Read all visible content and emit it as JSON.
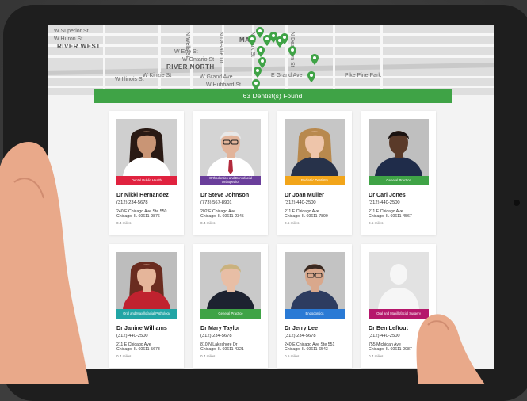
{
  "map": {
    "labels": [
      "W Superior St",
      "W Huron St",
      "RIVER WEST",
      "W Erie St",
      "W Ontario St",
      "RIVER NORTH",
      "W Grand Ave",
      "W Illinois St",
      "W Hubbard St",
      "W Kinzie St",
      "N Wells St",
      "N LaSalle Dr",
      "N Clark St",
      "N Dearborn St",
      "MA",
      "Pike Pine Park",
      "E Grand Ave"
    ]
  },
  "results": {
    "count_label": "63 Dentist(s) Found"
  },
  "dentists": [
    {
      "name": "Dr Nikki Hernandez",
      "specialty": "Dental Public Health",
      "specialty_color": "#e0223f",
      "phone": "(312) 234-5678",
      "address_line1": "240 E Chicago Ave Ste 550",
      "address_line2": "Chicago, IL 60611-9876",
      "distance": "0.4 miles",
      "photo": "woman-dark-hair"
    },
    {
      "name": "Dr Steve Johnson",
      "specialty": "Orthodontics and Dentofacial Orthopedics",
      "specialty_color": "#6a3e9b",
      "phone": "(773) 567-8901",
      "address_line1": "202 E Chicago Ave",
      "address_line2": "Chicago, IL 60611-2345",
      "distance": "0.4 miles",
      "photo": "older-man-glasses"
    },
    {
      "name": "Dr Joan Muller",
      "specialty": "Pediatric Dentistry",
      "specialty_color": "#f2a51a",
      "phone": "(312) 440-2500",
      "address_line1": "211 E Chicago Ave",
      "address_line2": "Chicago, IL 60611-7890",
      "distance": "0.5 miles",
      "photo": "woman-blonde"
    },
    {
      "name": "Dr Carl Jones",
      "specialty": "General Practice",
      "specialty_color": "#3fa346",
      "phone": "(312) 440-2500",
      "address_line1": "211 E Chicago Ave",
      "address_line2": "Chicago, IL 60611-4567",
      "distance": "0.5 miles",
      "photo": "man-dark-skin"
    },
    {
      "name": "Dr Janine Williams",
      "specialty": "Oral and Maxillofacial Pathology",
      "specialty_color": "#22a5a5",
      "phone": "(312) 440-2500",
      "address_line1": "211 E Chicago Ave",
      "address_line2": "Chicago, IL 60611-5678",
      "distance": "0.4 miles",
      "photo": "woman-auburn"
    },
    {
      "name": "Dr Mary Taylor",
      "specialty": "General Practice",
      "specialty_color": "#3fa346",
      "phone": "(312) 234-5678",
      "address_line1": "810 N Lakeshore Dr",
      "address_line2": "Chicago, IL 60611-4321",
      "distance": "0.4 miles",
      "photo": "older-woman"
    },
    {
      "name": "Dr Jerry Lee",
      "specialty": "Endodontics",
      "specialty_color": "#2a7ad5",
      "phone": "(312) 234-5678",
      "address_line1": "240 E Chicago Ave Ste 551",
      "address_line2": "Chicago, IL 60611-6543",
      "distance": "0.5 miles",
      "photo": "man-glasses"
    },
    {
      "name": "Dr Ben Leftout",
      "specialty": "Oral and Maxillofacial Surgery",
      "specialty_color": "#b5176b",
      "phone": "(312) 440-2500",
      "address_line1": "755 Michigan Ave",
      "address_line2": "Chicago, IL 60611-0987",
      "distance": "0.4 miles",
      "photo": "placeholder-silhouette"
    }
  ]
}
